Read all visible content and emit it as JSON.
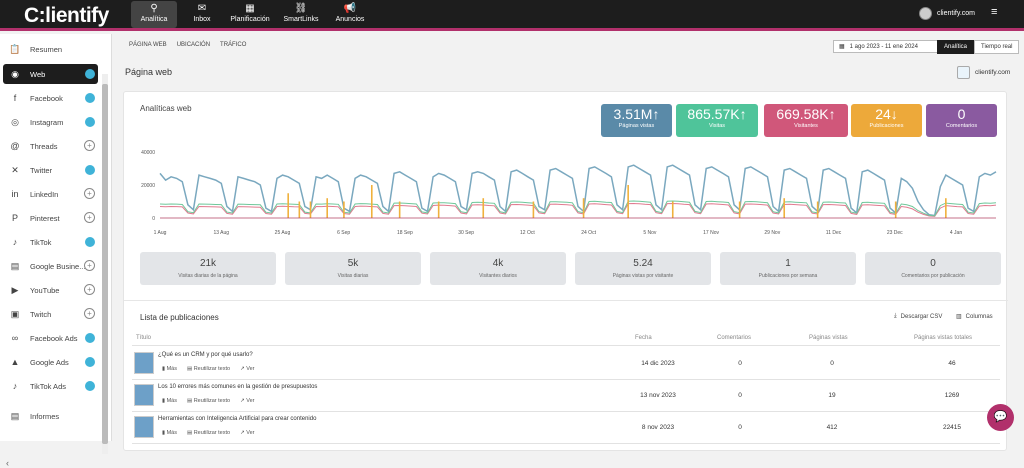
{
  "app": {
    "logo": "C:lientify",
    "account": "clientify.com"
  },
  "topnav": [
    {
      "label": "Analítica",
      "icon": "⚲"
    },
    {
      "label": "Inbox",
      "icon": "✉"
    },
    {
      "label": "Planificación",
      "icon": "▦"
    },
    {
      "label": "SmartLinks",
      "icon": "⛓"
    },
    {
      "label": "Anuncios",
      "icon": "📢"
    }
  ],
  "sidebar": {
    "items": [
      {
        "label": "Resumen",
        "icon": "📋"
      },
      {
        "label": "Web",
        "icon": "◉"
      },
      {
        "label": "Facebook",
        "icon": "f"
      },
      {
        "label": "Instagram",
        "icon": "◎"
      },
      {
        "label": "Threads",
        "icon": "@"
      },
      {
        "label": "Twitter",
        "icon": "✕"
      },
      {
        "label": "LinkedIn",
        "icon": "in"
      },
      {
        "label": "Pinterest",
        "icon": "P"
      },
      {
        "label": "TikTok",
        "icon": "♪"
      },
      {
        "label": "Google Busine...",
        "icon": "▤"
      },
      {
        "label": "YouTube",
        "icon": "▶"
      },
      {
        "label": "Twitch",
        "icon": "▣"
      },
      {
        "label": "Facebook Ads",
        "icon": "∞"
      },
      {
        "label": "Google Ads",
        "icon": "▲"
      },
      {
        "label": "TikTok Ads",
        "icon": "♪"
      },
      {
        "label": "Informes",
        "icon": "▤"
      }
    ]
  },
  "subtabs": [
    "PÁGINA WEB",
    "UBICACIÓN",
    "TRÁFICO"
  ],
  "date_range": "1 ago 2023 - 11 ene 2024",
  "toggle": [
    "Analítica",
    "Tiempo real"
  ],
  "page_title": "Página web",
  "page_account": "clientify.com",
  "card_title": "Analíticas web",
  "kpis": [
    {
      "value": "3.51M",
      "arrow": "↑",
      "label": "Páginas vistas",
      "color": "#5a8aa8"
    },
    {
      "value": "865.57K",
      "arrow": "↑",
      "label": "Visitas",
      "color": "#4fc49a"
    },
    {
      "value": "669.58K",
      "arrow": "↑",
      "label": "Visitantes",
      "color": "#d0577a"
    },
    {
      "value": "24",
      "arrow": "↓",
      "label": "Publicaciones",
      "color": "#eda93a"
    },
    {
      "value": "0",
      "arrow": "",
      "label": "Comentarios",
      "color": "#8a5aa0"
    }
  ],
  "chart_data": {
    "type": "line",
    "y_ticks": [
      "40000",
      "20000",
      "0"
    ],
    "x_labels": [
      "1 Aug",
      "13 Aug",
      "25 Aug",
      "6 Sep",
      "18 Sep",
      "30 Sep",
      "12 Oct",
      "24 Oct",
      "5 Nov",
      "17 Nov",
      "29 Nov",
      "11 Dec",
      "23 Dec",
      "4 Jan"
    ],
    "ylim": [
      0,
      40000
    ],
    "series": [
      {
        "values": [
          27000,
          23000,
          25000,
          24000,
          22000,
          8000,
          5000,
          26000,
          25000,
          24000,
          23000,
          21000,
          7000,
          4000,
          25000,
          24000,
          23000,
          22000,
          20000,
          6000,
          4000,
          24000,
          26000,
          25000,
          23000,
          21000,
          7000,
          5000,
          25000,
          24000,
          26000,
          24000,
          22000,
          6000,
          4000,
          24000,
          26000,
          25000,
          23000,
          21000,
          7000,
          4000,
          27000,
          28000,
          26000,
          24000,
          22000,
          6000,
          4000,
          25000,
          27000,
          26000,
          24000,
          22000,
          7000,
          5000,
          27000,
          28000,
          27000,
          25000,
          23000,
          7000,
          4000,
          28000,
          29000,
          27000,
          25000,
          23000,
          7000,
          5000,
          29000,
          30000,
          28000,
          26000,
          24000,
          7000,
          4000,
          30000,
          31000,
          29000,
          27000,
          25000,
          8000,
          5000,
          31000,
          32000,
          30000,
          28000,
          26000,
          8000,
          5000,
          31000,
          32000,
          30000,
          28000,
          26000,
          8000,
          5000,
          30000,
          31000,
          29000,
          27000,
          25000,
          8000,
          5000,
          30000,
          31000,
          29000,
          27000,
          25000,
          7000,
          4000,
          29000,
          30000,
          28000,
          26000,
          24000,
          7000,
          4000,
          29000,
          30000,
          28000,
          26000,
          24000,
          6000,
          3000,
          28000,
          29000,
          27000,
          25000,
          23000,
          6000,
          3000,
          24000,
          22000,
          18000,
          10000,
          5000,
          2000,
          1500,
          19000,
          26000,
          24000,
          22000,
          20000,
          6000,
          4000,
          25000,
          27000,
          26000,
          28000
        ],
        "color": "#7aa8bf"
      },
      {
        "values": [
          7000,
          6800,
          7000,
          6900,
          6700,
          3000,
          2500,
          7000,
          6900,
          6800,
          6700,
          6600,
          2800,
          2300,
          6900,
          6800,
          6700,
          6600,
          6500,
          2700,
          2300,
          7000,
          7100,
          7000,
          6800,
          6700,
          2800,
          2400,
          7000,
          6900,
          7100,
          7000,
          6800,
          2700,
          2300,
          7000,
          7200,
          7100,
          6900,
          6700,
          2800,
          2300,
          7500,
          7600,
          7400,
          7200,
          7000,
          2900,
          2400,
          7600,
          7800,
          7700,
          7500,
          7200,
          3000,
          2500,
          7900,
          8000,
          7900,
          7600,
          7400,
          3000,
          2400,
          8100,
          8200,
          8000,
          7800,
          7500,
          3100,
          2600,
          8300,
          8400,
          8200,
          8000,
          7700,
          3100,
          2500,
          8500,
          8600,
          8400,
          8100,
          7900,
          3200,
          2600,
          8700,
          8800,
          8600,
          8300,
          8100,
          3200,
          2600,
          8700,
          8800,
          8600,
          8300,
          8100,
          3200,
          2600,
          8500,
          8600,
          8400,
          8200,
          7900,
          3100,
          2500,
          8400,
          8500,
          8300,
          8100,
          7800,
          3000,
          2400,
          8200,
          8300,
          8100,
          7900,
          7700,
          2900,
          2400,
          8100,
          8200,
          8000,
          7800,
          7600,
          2800,
          2200,
          7900,
          8000,
          7800,
          7600,
          7400,
          2700,
          2100,
          7000,
          6500,
          5500,
          3500,
          2200,
          1200,
          1000,
          6000,
          7500,
          7200,
          6900,
          6700,
          2700,
          2300,
          7200,
          7600,
          7400,
          7800
        ],
        "color": "#e07a8f"
      },
      {
        "values": [
          8500,
          8300,
          8500,
          8400,
          8200,
          3800,
          3200,
          8500,
          8400,
          8300,
          8200,
          8100,
          3600,
          3000,
          8400,
          8300,
          8200,
          8100,
          8000,
          3500,
          3000,
          8500,
          8600,
          8500,
          8300,
          8200,
          3600,
          3100,
          8500,
          8400,
          8600,
          8500,
          8300,
          3500,
          3000,
          8500,
          8700,
          8600,
          8400,
          8200,
          3600,
          3000,
          9000,
          9100,
          8900,
          8700,
          8500,
          3700,
          3100,
          9100,
          9300,
          9200,
          9000,
          8700,
          3800,
          3200,
          9400,
          9500,
          9400,
          9100,
          8900,
          3800,
          3100,
          9600,
          9700,
          9500,
          9300,
          9000,
          3900,
          3300,
          9800,
          9900,
          9700,
          9500,
          9200,
          3900,
          3200,
          10000,
          10100,
          9900,
          9600,
          9400,
          4000,
          3300,
          10200,
          10300,
          10100,
          9800,
          9600,
          4000,
          3300,
          10200,
          10300,
          10100,
          9800,
          9600,
          4000,
          3300,
          10000,
          10100,
          9900,
          9700,
          9400,
          3900,
          3200,
          9900,
          10000,
          9800,
          9600,
          9300,
          3800,
          3100,
          9700,
          9800,
          9600,
          9400,
          9200,
          3700,
          3100,
          9600,
          9700,
          9500,
          9300,
          9100,
          3600,
          2900,
          9400,
          9500,
          9300,
          9100,
          8900,
          3500,
          2800,
          8500,
          8000,
          7000,
          4500,
          2900,
          1600,
          1300,
          7500,
          9000,
          8700,
          8400,
          8200,
          3500,
          3000,
          8700,
          9100,
          8900,
          9300
        ],
        "color": "#6fc79a"
      },
      {
        "bars": [
          {
            "x": 23,
            "v": 15000
          },
          {
            "x": 25,
            "v": 10000
          },
          {
            "x": 27,
            "v": 10000
          },
          {
            "x": 30,
            "v": 12000
          },
          {
            "x": 33,
            "v": 10000
          },
          {
            "x": 38,
            "v": 20000
          },
          {
            "x": 43,
            "v": 10000
          },
          {
            "x": 50,
            "v": 10000
          },
          {
            "x": 58,
            "v": 12000
          },
          {
            "x": 67,
            "v": 10000
          },
          {
            "x": 76,
            "v": 12000
          },
          {
            "x": 84,
            "v": 20000
          },
          {
            "x": 92,
            "v": 10000
          },
          {
            "x": 104,
            "v": 10000
          },
          {
            "x": 112,
            "v": 12000
          },
          {
            "x": 118,
            "v": 10000
          },
          {
            "x": 132,
            "v": 10000
          },
          {
            "x": 141,
            "v": 12000
          }
        ],
        "color": "#f0b13c"
      }
    ]
  },
  "stats": [
    {
      "value": "21k",
      "label": "Visitas diarias de la página"
    },
    {
      "value": "5k",
      "label": "Visitas diarias"
    },
    {
      "value": "4k",
      "label": "Visitantes diarios"
    },
    {
      "value": "5.24",
      "label": "Páginas vistas por visitante"
    },
    {
      "value": "1",
      "label": "Publicaciones por semana"
    },
    {
      "value": "0",
      "label": "Comentarios por publicación"
    }
  ],
  "list": {
    "title": "Lista de publicaciones",
    "csv": "Descargar CSV",
    "columns_btn": "Columnas",
    "headers": [
      "Título",
      "Fecha",
      "Comentarios",
      "Páginas vistas",
      "Páginas vistas totales"
    ],
    "actions": [
      "Más",
      "Reutilizar texto",
      "Ver"
    ],
    "rows": [
      {
        "title": "¿Qué es un CRM y por qué usarlo?",
        "date": "14 dic 2023",
        "comments": "0",
        "views": "0",
        "total": "46"
      },
      {
        "title": "Los 10 errores más comunes en la gestión de presupuestos",
        "date": "13 nov 2023",
        "comments": "0",
        "views": "19",
        "total": "1269"
      },
      {
        "title": "Herramientas con Inteligencia Artificial para crear contenido",
        "date": "8 nov 2023",
        "comments": "0",
        "views": "412",
        "total": "22415"
      }
    ]
  }
}
